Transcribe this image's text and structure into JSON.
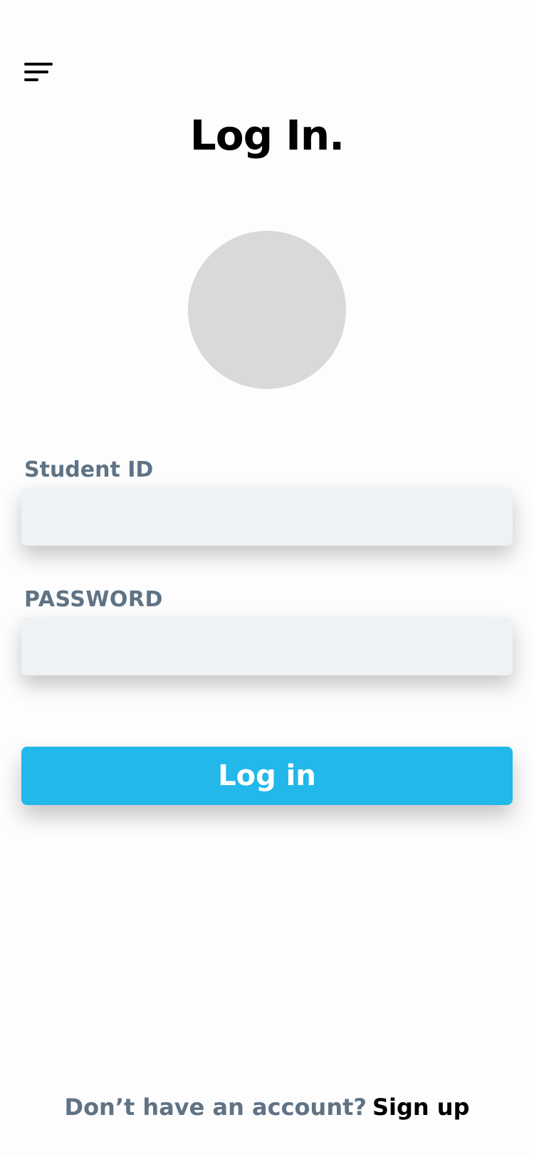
{
  "header": {
    "menu_icon": "hamburger-menu-icon",
    "title": "Log In."
  },
  "profile": {
    "avatar_color": "#d9d9d9"
  },
  "form": {
    "student_id_label": "Student ID",
    "student_id_value": "",
    "student_id_placeholder": "",
    "password_label": "PASSWORD",
    "password_value": "",
    "password_placeholder": "",
    "login_button_label": "Log in",
    "login_button_color": "#22b8ea"
  },
  "footer": {
    "prompt": "Don’t have an account?",
    "signup_label": "Sign up"
  },
  "colors": {
    "label_text": "#5f7385",
    "field_background": "#eff2f5",
    "page_background": "#fdfdfd"
  }
}
